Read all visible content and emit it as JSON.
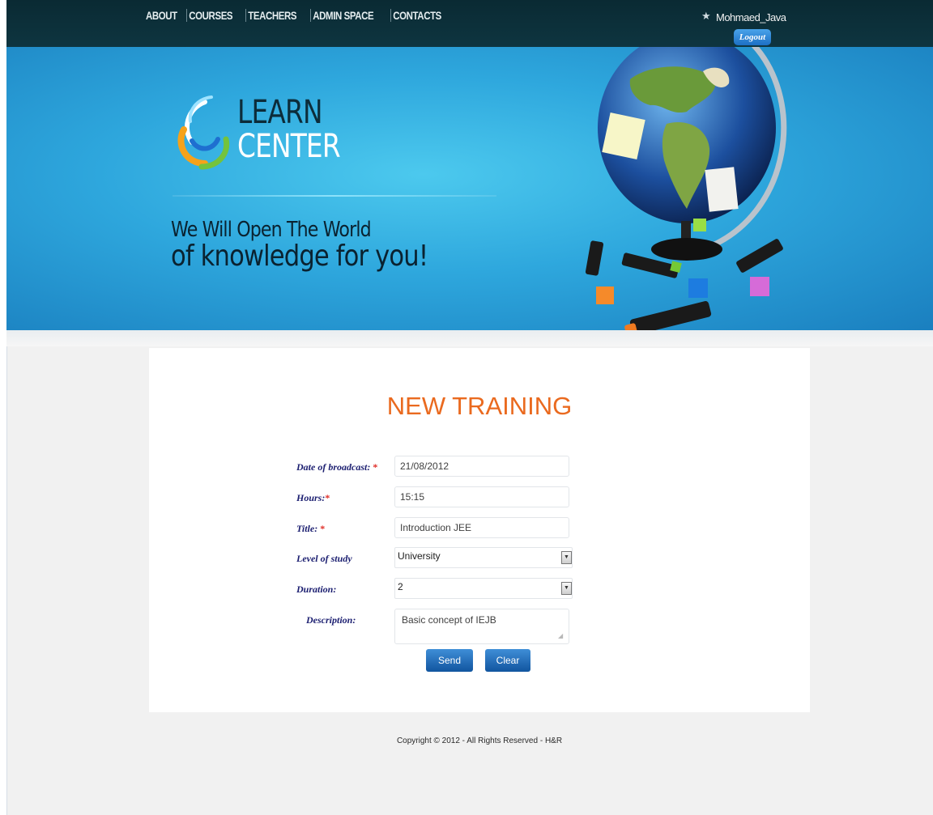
{
  "nav": {
    "items": [
      {
        "label": "ABOUT"
      },
      {
        "label": "COURSES"
      },
      {
        "label": "TEACHERS"
      },
      {
        "label": "ADMIN SPACE"
      },
      {
        "label": "CONTACTS"
      }
    ]
  },
  "user": {
    "name": "Mohmaed_Java",
    "logout_label": "Logout"
  },
  "hero": {
    "logo_line1": "LEARN",
    "logo_line2": "CENTER",
    "slogan_line1": "We Will Open The World",
    "slogan_line2": "of knowledge for you!"
  },
  "form": {
    "title": "NEW TRAINING",
    "required_mark": "*",
    "fields": {
      "date": {
        "label": "Date of broadcast:",
        "value": "21/08/2012"
      },
      "hours": {
        "label": "Hours:",
        "value": "15:15"
      },
      "title": {
        "label": "Title:",
        "value": "Introduction JEE"
      },
      "level": {
        "label": "Level of study",
        "value": "University"
      },
      "duration": {
        "label": "Duration:",
        "value": "2"
      },
      "description": {
        "label": "Description:",
        "value": "Basic concept of IEJB"
      }
    },
    "send_label": "Send",
    "clear_label": "Clear"
  },
  "footer": {
    "copyright": "Copyright © 2012 - All Rights Reserved - H&R"
  },
  "colors": {
    "nav_bg": "#0e3540",
    "hero_blue": "#2ea7dd",
    "title_orange": "#ea6a1f",
    "label_navy": "#1b1e70",
    "button_blue": "#1c6fc4"
  }
}
